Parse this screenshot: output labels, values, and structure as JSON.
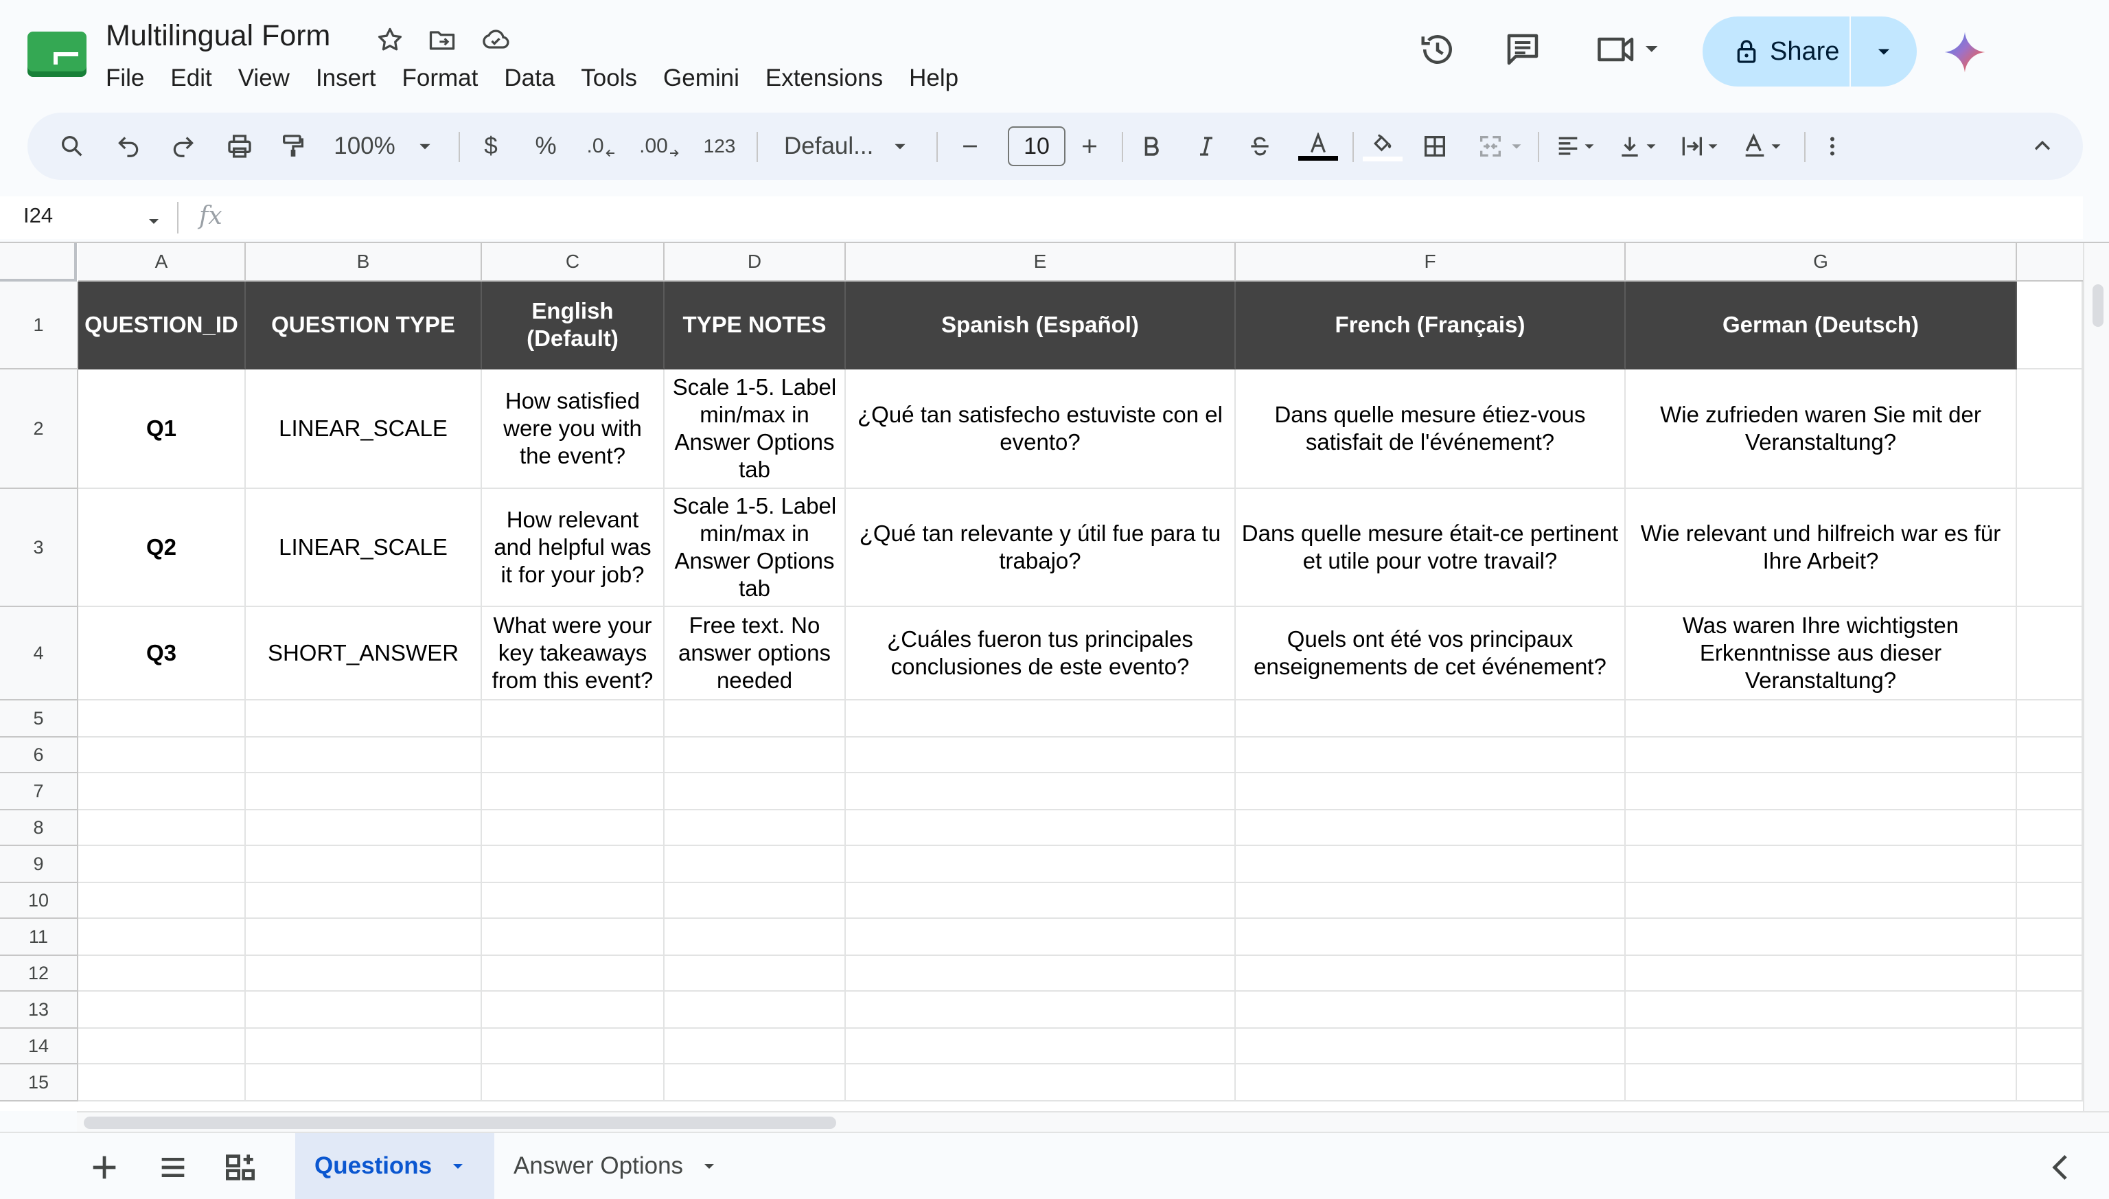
{
  "doc": {
    "title": "Multilingual Form"
  },
  "menu": [
    "File",
    "Edit",
    "View",
    "Insert",
    "Format",
    "Data",
    "Tools",
    "Gemini",
    "Extensions",
    "Help"
  ],
  "share": {
    "label": "Share"
  },
  "toolbar": {
    "zoom": "100%",
    "currency": "$",
    "percent": "%",
    "dec_decrease": ".0",
    "dec_increase": ".00",
    "number_format": "123",
    "font": "Defaul...",
    "font_size": "10"
  },
  "formula_bar": {
    "cell_ref": "I24",
    "fx": "fx"
  },
  "columns": [
    "A",
    "B",
    "C",
    "D",
    "E",
    "F",
    "G"
  ],
  "rows": [
    "1",
    "2",
    "3",
    "4",
    "5",
    "6",
    "7",
    "8",
    "9",
    "10",
    "11",
    "12",
    "13",
    "14",
    "15"
  ],
  "table": {
    "headers": [
      "QUESTION_ID",
      "QUESTION TYPE",
      "English (Default)",
      "TYPE NOTES",
      "Spanish (Español)",
      "French (Français)",
      "German (Deutsch)"
    ],
    "data": [
      [
        "Q1",
        "LINEAR_SCALE",
        "How satisfied were you with the event?",
        "Scale 1-5. Label min/max in Answer Options tab",
        "¿Qué tan satisfecho estuviste con el evento?",
        "Dans quelle mesure étiez-vous satisfait de l'événement?",
        "Wie zufrieden waren Sie mit der Veranstaltung?"
      ],
      [
        "Q2",
        "LINEAR_SCALE",
        "How relevant and helpful was it for your job?",
        "Scale 1-5. Label min/max in Answer Options tab",
        "¿Qué tan relevante y útil fue para tu trabajo?",
        "Dans quelle mesure était-ce pertinent et utile pour votre travail?",
        "Wie relevant und hilfreich war es für Ihre Arbeit?"
      ],
      [
        "Q3",
        "SHORT_ANSWER",
        "What were your key takeaways from this event?",
        "Free text. No answer options needed",
        "¿Cuáles fueron tus principales conclusiones de este evento?",
        "Quels ont été vos principaux enseignements de cet événement?",
        "Was waren Ihre wichtigsten Erkenntnisse aus dieser Veranstaltung?"
      ]
    ]
  },
  "sheets": [
    {
      "label": "Questions",
      "active": true
    },
    {
      "label": "Answer Options",
      "active": false
    }
  ],
  "colors": {
    "header_fill": "#434343",
    "accent": "#0b57d0",
    "share_bg": "#c2e7ff",
    "sheets_green": "#0f9d58"
  }
}
